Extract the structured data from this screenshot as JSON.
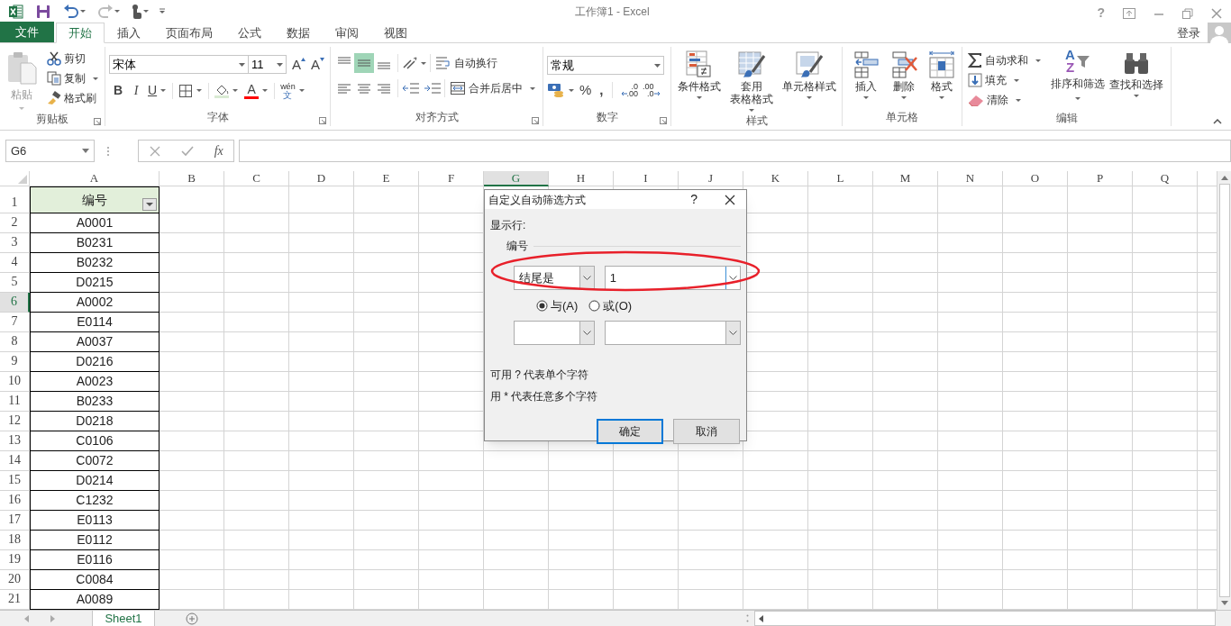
{
  "window": {
    "title": "工作簿1 - Excel",
    "help": "?"
  },
  "tabs": [
    {
      "label": "文件",
      "kind": "file",
      "selected": false
    },
    {
      "label": "开始",
      "kind": "tab",
      "selected": true
    },
    {
      "label": "插入",
      "kind": "tab",
      "selected": false
    },
    {
      "label": "页面布局",
      "kind": "tab",
      "selected": false
    },
    {
      "label": "公式",
      "kind": "tab",
      "selected": false
    },
    {
      "label": "数据",
      "kind": "tab",
      "selected": false
    },
    {
      "label": "审阅",
      "kind": "tab",
      "selected": false
    },
    {
      "label": "视图",
      "kind": "tab",
      "selected": false
    }
  ],
  "account": {
    "label": "登录"
  },
  "ribbon": {
    "clipboard": {
      "title": "剪贴板",
      "paste": "粘贴",
      "cut": "剪切",
      "copy": "复制",
      "painter": "格式刷"
    },
    "font": {
      "title": "字体",
      "font_name": "宋体",
      "font_size": "11",
      "grow": "A",
      "shrink": "A",
      "bold": "B",
      "italic": "I",
      "underline": "U",
      "font_color": "A",
      "phonetic": [
        "wén",
        "文"
      ]
    },
    "alignment": {
      "title": "对齐方式",
      "vertical_align": [
        {
          "selected": false
        },
        {
          "selected": true
        },
        {
          "selected": false
        }
      ],
      "wrap": "自动换行",
      "merge": "合并后居中"
    },
    "number": {
      "title": "数字",
      "format": "常规",
      "percent": "%",
      "comma": ",",
      "increase_decimal": [
        ".0",
        ".00"
      ],
      "decrease_decimal": [
        ".00",
        ".0"
      ]
    },
    "styles": {
      "title": "样式",
      "conditional": [
        "条件格式"
      ],
      "table": [
        "套用",
        "表格格式"
      ],
      "cell_styles": [
        "单元格样式"
      ]
    },
    "cells": {
      "title": "单元格",
      "insert": "插入",
      "delete": "删除",
      "format": "格式"
    },
    "editing": {
      "title": "编辑",
      "autosum": "自动求和",
      "fill": "填充",
      "clear": "清除",
      "sort": "排序和筛选",
      "sort_letters": [
        "A",
        "Z"
      ],
      "find": "查找和选择"
    }
  },
  "formula_bar": {
    "name_box": "G6",
    "function_label": "fx"
  },
  "columns": [
    {
      "label": "A",
      "selected": false
    },
    {
      "label": "B",
      "selected": false
    },
    {
      "label": "C",
      "selected": false
    },
    {
      "label": "D",
      "selected": false
    },
    {
      "label": "E",
      "selected": false
    },
    {
      "label": "F",
      "selected": false
    },
    {
      "label": "G",
      "selected": true
    },
    {
      "label": "H",
      "selected": false
    },
    {
      "label": "I",
      "selected": false
    },
    {
      "label": "J",
      "selected": false
    },
    {
      "label": "K",
      "selected": false
    },
    {
      "label": "L",
      "selected": false
    },
    {
      "label": "M",
      "selected": false
    },
    {
      "label": "N",
      "selected": false
    },
    {
      "label": "O",
      "selected": false
    },
    {
      "label": "P",
      "selected": false
    },
    {
      "label": "Q",
      "selected": false
    }
  ],
  "rows": [
    {
      "label": "1",
      "selected": false,
      "kind": "header",
      "cell": "编号"
    },
    {
      "label": "2",
      "selected": false,
      "kind": "data",
      "cell": "A0001"
    },
    {
      "label": "3",
      "selected": false,
      "kind": "data",
      "cell": "B0231"
    },
    {
      "label": "4",
      "selected": false,
      "kind": "data",
      "cell": "B0232"
    },
    {
      "label": "5",
      "selected": false,
      "kind": "data",
      "cell": "D0215"
    },
    {
      "label": "6",
      "selected": true,
      "kind": "data",
      "cell": "A0002"
    },
    {
      "label": "7",
      "selected": false,
      "kind": "data",
      "cell": "E0114"
    },
    {
      "label": "8",
      "selected": false,
      "kind": "data",
      "cell": "A0037"
    },
    {
      "label": "9",
      "selected": false,
      "kind": "data",
      "cell": "D0216"
    },
    {
      "label": "10",
      "selected": false,
      "kind": "data",
      "cell": "A0023"
    },
    {
      "label": "11",
      "selected": false,
      "kind": "data",
      "cell": "B0233"
    },
    {
      "label": "12",
      "selected": false,
      "kind": "data",
      "cell": "D0218"
    },
    {
      "label": "13",
      "selected": false,
      "kind": "data",
      "cell": "C0106"
    },
    {
      "label": "14",
      "selected": false,
      "kind": "data",
      "cell": "C0072"
    },
    {
      "label": "15",
      "selected": false,
      "kind": "data",
      "cell": "D0214"
    },
    {
      "label": "16",
      "selected": false,
      "kind": "data",
      "cell": "C1232"
    },
    {
      "label": "17",
      "selected": false,
      "kind": "data",
      "cell": "E0113"
    },
    {
      "label": "18",
      "selected": false,
      "kind": "data",
      "cell": "E0112"
    },
    {
      "label": "19",
      "selected": false,
      "kind": "data",
      "cell": "E0116"
    },
    {
      "label": "20",
      "selected": false,
      "kind": "data",
      "cell": "C0084"
    },
    {
      "label": "21",
      "selected": false,
      "kind": "data",
      "cell": "A0089"
    }
  ],
  "sheets": [
    {
      "label": "Sheet1",
      "selected": true
    }
  ],
  "dialog": {
    "title": "自定义自动筛选方式",
    "help": "?",
    "show_rows": "显示行:",
    "field": "编号",
    "condition_1": {
      "operator": "结尾是",
      "value": "1",
      "highlighted": true
    },
    "logic": [
      {
        "label": "与(A)",
        "selected": true
      },
      {
        "label": "或(O)",
        "selected": false
      }
    ],
    "hints": [
      "可用 ? 代表单个字符",
      "用 * 代表任意多个字符"
    ],
    "ok": "确定",
    "cancel": "取消"
  }
}
